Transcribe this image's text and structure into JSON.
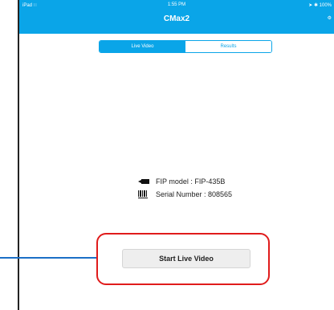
{
  "status_bar": {
    "carrier": "iPad",
    "time": "1:55 PM",
    "battery": "100%"
  },
  "header": {
    "title": "CMax2"
  },
  "segmented": {
    "live_label": "Live Video",
    "results_label": "Results"
  },
  "device": {
    "model_text": "FIP model : FIP-435B",
    "serial_text": "Serial Number : 808565"
  },
  "actions": {
    "start_label": "Start Live Video"
  },
  "colors": {
    "accent": "#0aa5e8",
    "callout_red": "#e01b1b",
    "pointer_blue": "#1b6fc6"
  }
}
